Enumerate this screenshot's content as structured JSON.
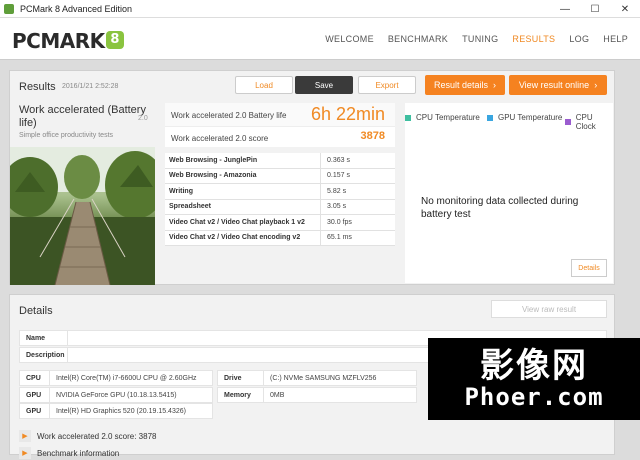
{
  "window": {
    "title": "PCMark 8 Advanced Edition",
    "controls": {
      "minimize": "—",
      "maximize": "☐",
      "close": "✕"
    }
  },
  "brand": {
    "logo_text": "PCMARK",
    "logo_badge": "8"
  },
  "nav": {
    "items": [
      "WELCOME",
      "BENCHMARK",
      "TUNING",
      "RESULTS",
      "LOG",
      "HELP"
    ],
    "active": "RESULTS"
  },
  "results": {
    "title": "Results",
    "date": "2016/1/21 2:52:28",
    "buttons": {
      "load": "Load",
      "save": "Save",
      "export": "Export",
      "result_details": "Result details",
      "view_online": "View result online"
    },
    "benchmark": {
      "name": "Work accelerated (Battery life)",
      "version": "2.0",
      "subtitle": "Simple office productivity tests"
    },
    "battery_label": "Work accelerated 2.0 Battery life",
    "battery_value": "6h 22min",
    "score_label": "Work accelerated 2.0 score",
    "score_value": "3878",
    "subtests": [
      {
        "name": "Web Browsing - JunglePin",
        "value": "0.363 s"
      },
      {
        "name": "Web Browsing - Amazonia",
        "value": "0.157 s"
      },
      {
        "name": "Writing",
        "value": "5.82 s"
      },
      {
        "name": "Spreadsheet",
        "value": "3.05 s"
      },
      {
        "name": "Video Chat v2 / Video Chat playback 1 v2",
        "value": "30.0 fps"
      },
      {
        "name": "Video Chat v2 / Video Chat encoding v2",
        "value": "65.1 ms"
      }
    ],
    "monitoring": {
      "legend": [
        {
          "label": "CPU Temperature",
          "color": "#3fbfa0"
        },
        {
          "label": "GPU Temperature",
          "color": "#3aa6e0"
        },
        {
          "label": "CPU Clock",
          "color": "#9a5ccf"
        }
      ],
      "no_data_text": "No monitoring data collected during battery test",
      "details_button": "Details"
    }
  },
  "details": {
    "title": "Details",
    "view_raw": "View raw result",
    "fields": [
      {
        "key": "Name",
        "value": ""
      },
      {
        "key": "Description",
        "value": ""
      }
    ],
    "system_left": [
      {
        "key": "CPU",
        "value": "Intel(R) Core(TM) i7-6600U CPU @ 2.60GHz"
      },
      {
        "key": "GPU",
        "value": "NVIDIA GeForce GPU (10.18.13.5415)"
      },
      {
        "key": "GPU",
        "value": "Intel(R) HD Graphics 520 (20.19.15.4326)"
      }
    ],
    "system_mid": [
      {
        "key": "Drive",
        "value": "(C:) NVMe SAMSUNG MZFLV256"
      },
      {
        "key": "Memory",
        "value": "0MB"
      }
    ],
    "expanders": [
      "Work accelerated 2.0 score: 3878",
      "Benchmark information"
    ]
  },
  "watermark": {
    "cn": "影像网",
    "en": "Phoer.com"
  }
}
